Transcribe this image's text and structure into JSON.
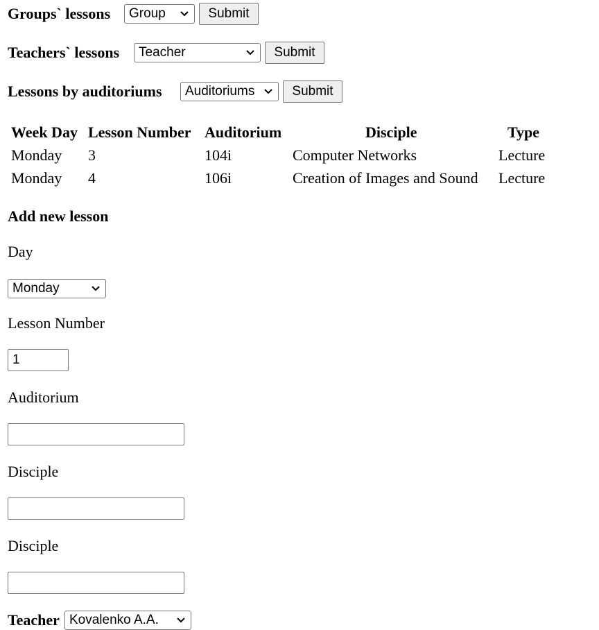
{
  "filters": {
    "groups": {
      "label": "Groups` lessons",
      "selected": "Group",
      "submit": "Submit"
    },
    "teachers": {
      "label": "Teachers` lessons",
      "selected": "Teacher",
      "submit": "Submit"
    },
    "auditoriums": {
      "label": "Lessons by auditoriums",
      "selected": "Auditoriums",
      "submit": "Submit"
    }
  },
  "table": {
    "headers": [
      "Week Day",
      "Lesson Number",
      "Auditorium",
      "Disciple",
      "Type"
    ],
    "rows": [
      [
        "Monday",
        "3",
        "104i",
        "Computer Networks",
        "Lecture"
      ],
      [
        "Monday",
        "4",
        "106i",
        "Creation of Images and Sound",
        "Lecture"
      ]
    ]
  },
  "form": {
    "title": "Add new lesson",
    "day_label": "Day",
    "day_value": "Monday",
    "lesson_number_label": "Lesson Number",
    "lesson_number_value": "1",
    "auditorium_label": "Auditorium",
    "auditorium_value": "",
    "disciple_label": "Disciple",
    "disciple_value": "",
    "disciple2_label": "Disciple",
    "disciple2_value": "",
    "teacher_label": "Teacher",
    "teacher_value": "Kovalenko A.A."
  }
}
